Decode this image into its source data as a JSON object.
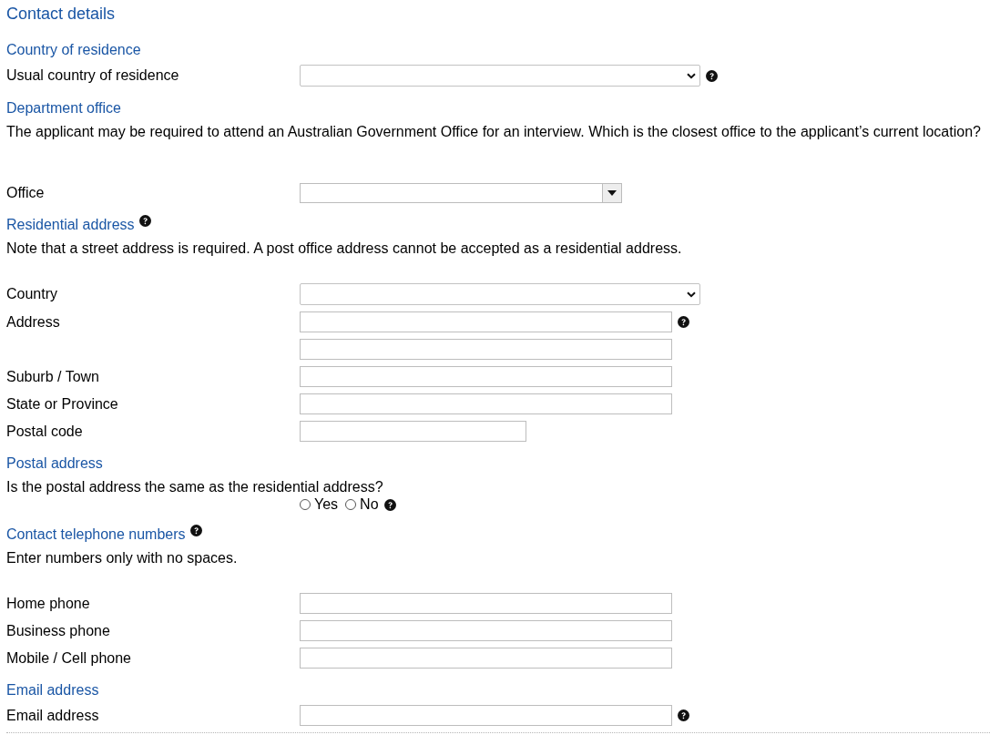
{
  "title": "Contact details",
  "sections": [
    {
      "heading": "Country of residence",
      "help": false,
      "fields": [
        {
          "kind": "select",
          "label": "Usual country of residence",
          "help": true
        }
      ]
    },
    {
      "heading": "Department office",
      "help": false,
      "notes": [
        {
          "kind": "note",
          "text": "The applicant may be required to attend an Australian Government Office for an interview. Which is the closest office to the applicant’s current location?"
        }
      ],
      "fields": [
        {
          "kind": "combo",
          "label": "Office",
          "help": false
        }
      ]
    },
    {
      "heading": "Residential address",
      "help": true,
      "notes": [
        {
          "kind": "note",
          "text": "Note that a street address is required. A post office address cannot be accepted as a residential address."
        }
      ],
      "fields": [
        {
          "kind": "select",
          "label": "Country",
          "help": false
        },
        {
          "kind": "text",
          "label": "Address",
          "help": true
        },
        {
          "kind": "text",
          "help": false
        },
        {
          "kind": "text",
          "label": "Suburb / Town",
          "help": false
        },
        {
          "kind": "text",
          "label": "State or Province",
          "help": false
        },
        {
          "kind": "short-text",
          "label": "Postal code",
          "help": false
        }
      ]
    },
    {
      "heading": "Postal address",
      "help": false,
      "notes": [
        {
          "kind": "question",
          "text": "Is the postal address the same as the residential address?"
        }
      ],
      "fields": [
        {
          "kind": "radio",
          "help": true,
          "options": [
            {
              "label": "Yes",
              "selected": false
            },
            {
              "label": "No",
              "selected": false
            }
          ]
        }
      ]
    },
    {
      "heading": "Contact telephone numbers",
      "help": true,
      "notes": [
        {
          "kind": "note",
          "text": "Enter numbers only with no spaces."
        }
      ],
      "fields": [
        {
          "kind": "text",
          "label": "Home phone",
          "help": false
        },
        {
          "kind": "text",
          "label": "Business phone",
          "help": false
        },
        {
          "kind": "text",
          "label": "Mobile / Cell phone",
          "help": false
        }
      ]
    },
    {
      "heading": "Email address",
      "help": false,
      "fields": [
        {
          "kind": "text",
          "label": "Email address",
          "help": true
        }
      ]
    }
  ]
}
